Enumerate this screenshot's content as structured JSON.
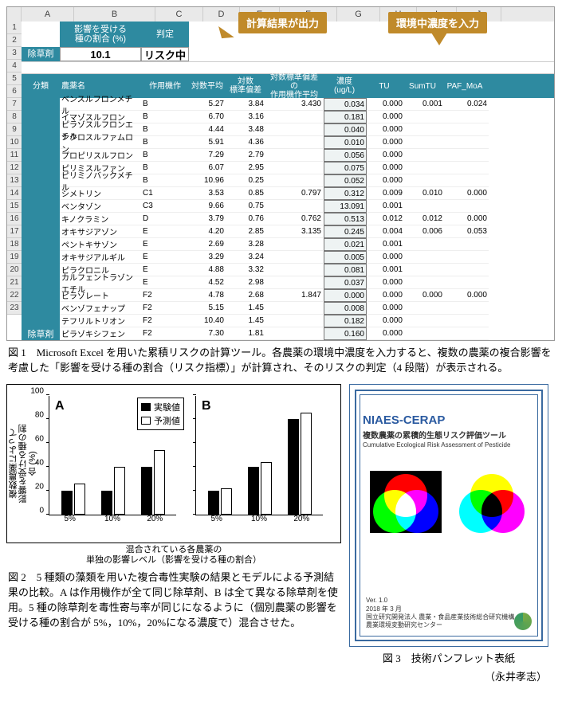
{
  "excel": {
    "col_letters": [
      "A",
      "B",
      "C",
      "D",
      "E",
      "F",
      "G",
      "H",
      "I",
      "J"
    ],
    "row_numbers": [
      "1",
      "2",
      "3",
      "4",
      "5",
      "6",
      "7",
      "8",
      "9",
      "10",
      "11",
      "12",
      "13",
      "14",
      "15",
      "16",
      "17",
      "18",
      "19",
      "20",
      "21",
      "22",
      "23"
    ],
    "top": {
      "ratio_header": "影響を受ける\n種の割合 (%)",
      "judgement_header": "判定",
      "category_label": "除草剤",
      "ratio_value": "10.1",
      "judgement_value": "リスク中"
    },
    "callouts": {
      "calc_out": "計算結果が出力",
      "conc_in": "環境中濃度を入力"
    },
    "headers": {
      "cat": "分類",
      "name": "農薬名",
      "moa": "作用機作",
      "logmean": "対数平均",
      "logsd": "対数\n標準偏差",
      "moasd": "対数標準偏差の\n作用機作平均",
      "conc": "濃度\n(ug/L)",
      "tu": "TU",
      "sumtu": "SumTU",
      "paf": "PAF_MoA"
    },
    "side_label": "除草剤",
    "rows": [
      {
        "name": "ベンスルフロンメチル",
        "moa": "B",
        "lm": "5.27",
        "lsd": "3.84",
        "msd": "3.430",
        "conc": "0.034",
        "tu": "0.000",
        "sumtu": "0.001",
        "paf": "0.024"
      },
      {
        "name": "イマゾスルフロン",
        "moa": "B",
        "lm": "6.70",
        "lsd": "3.16",
        "msd": "",
        "conc": "0.181",
        "tu": "0.000",
        "sumtu": "",
        "paf": ""
      },
      {
        "name": "ピラゾスルフロンエチル",
        "moa": "B",
        "lm": "4.44",
        "lsd": "3.48",
        "msd": "",
        "conc": "0.040",
        "tu": "0.000",
        "sumtu": "",
        "paf": ""
      },
      {
        "name": "シクロスルファムロン",
        "moa": "B",
        "lm": "5.91",
        "lsd": "4.36",
        "msd": "",
        "conc": "0.010",
        "tu": "0.000",
        "sumtu": "",
        "paf": ""
      },
      {
        "name": "プロピリスルフロン",
        "moa": "B",
        "lm": "7.29",
        "lsd": "2.79",
        "msd": "",
        "conc": "0.056",
        "tu": "0.000",
        "sumtu": "",
        "paf": ""
      },
      {
        "name": "ピリミスルファン",
        "moa": "B",
        "lm": "6.07",
        "lsd": "2.95",
        "msd": "",
        "conc": "0.075",
        "tu": "0.000",
        "sumtu": "",
        "paf": ""
      },
      {
        "name": "ピリミノバックメチル",
        "moa": "B",
        "lm": "10.96",
        "lsd": "0.25",
        "msd": "",
        "conc": "0.052",
        "tu": "0.000",
        "sumtu": "",
        "paf": ""
      },
      {
        "name": "シメトリン",
        "moa": "C1",
        "lm": "3.53",
        "lsd": "0.85",
        "msd": "0.797",
        "conc": "0.312",
        "tu": "0.009",
        "sumtu": "0.010",
        "paf": "0.000"
      },
      {
        "name": "ベンタゾン",
        "moa": "C3",
        "lm": "9.66",
        "lsd": "0.75",
        "msd": "",
        "conc": "13.091",
        "tu": "0.001",
        "sumtu": "",
        "paf": ""
      },
      {
        "name": "キノクラミン",
        "moa": "D",
        "lm": "3.79",
        "lsd": "0.76",
        "msd": "0.762",
        "conc": "0.513",
        "tu": "0.012",
        "sumtu": "0.012",
        "paf": "0.000"
      },
      {
        "name": "オキサジアゾン",
        "moa": "E",
        "lm": "4.20",
        "lsd": "2.85",
        "msd": "3.135",
        "conc": "0.245",
        "tu": "0.004",
        "sumtu": "0.006",
        "paf": "0.053"
      },
      {
        "name": "ペントキサゾン",
        "moa": "E",
        "lm": "2.69",
        "lsd": "3.28",
        "msd": "",
        "conc": "0.021",
        "tu": "0.001",
        "sumtu": "",
        "paf": ""
      },
      {
        "name": "オキサジアルギル",
        "moa": "E",
        "lm": "3.29",
        "lsd": "3.24",
        "msd": "",
        "conc": "0.005",
        "tu": "0.000",
        "sumtu": "",
        "paf": ""
      },
      {
        "name": "ピラクロニル",
        "moa": "E",
        "lm": "4.88",
        "lsd": "3.32",
        "msd": "",
        "conc": "0.081",
        "tu": "0.001",
        "sumtu": "",
        "paf": ""
      },
      {
        "name": "カルフェントラゾンエチル",
        "moa": "E",
        "lm": "4.52",
        "lsd": "2.98",
        "msd": "",
        "conc": "0.037",
        "tu": "0.000",
        "sumtu": "",
        "paf": ""
      },
      {
        "name": "ピラゾレート",
        "moa": "F2",
        "lm": "4.78",
        "lsd": "2.68",
        "msd": "1.847",
        "conc": "0.000",
        "tu": "0.000",
        "sumtu": "0.000",
        "paf": "0.000"
      },
      {
        "name": "ベンゾフェナップ",
        "moa": "F2",
        "lm": "5.15",
        "lsd": "1.45",
        "msd": "",
        "conc": "0.008",
        "tu": "0.000",
        "sumtu": "",
        "paf": ""
      },
      {
        "name": "テフリルトリオン",
        "moa": "F2",
        "lm": "10.40",
        "lsd": "1.45",
        "msd": "",
        "conc": "0.182",
        "tu": "0.000",
        "sumtu": "",
        "paf": ""
      },
      {
        "name": "ピラゾキシフェン",
        "moa": "F2",
        "lm": "7.30",
        "lsd": "1.81",
        "msd": "",
        "conc": "0.160",
        "tu": "0.000",
        "sumtu": "",
        "paf": ""
      }
    ]
  },
  "caption1": "図 1　Microsoft Excel を用いた累積リスクの計算ツール。各農薬の環境中濃度を入力すると、複数の農薬の複合影響を考慮した「影響を受ける種の割合（リスク指標）」が計算され、そのリスクの判定（4 段階）が表示される。",
  "chart_data": [
    {
      "type": "bar",
      "panel": "A",
      "categories": [
        "5%",
        "10%",
        "20%"
      ],
      "series": [
        {
          "name": "実験値",
          "values": [
            20,
            20,
            40
          ]
        },
        {
          "name": "予測値",
          "values": [
            26,
            40,
            54
          ]
        }
      ],
      "ylim": [
        0,
        100
      ],
      "ylabel": "複数農薬によって\n影響を受ける種の割合 (%)",
      "xlabel": "混合されている各農薬の\n単独の影響レベル（影響を受ける種の割合）"
    },
    {
      "type": "bar",
      "panel": "B",
      "categories": [
        "5%",
        "10%",
        "20%"
      ],
      "series": [
        {
          "name": "実験値",
          "values": [
            20,
            40,
            80
          ]
        },
        {
          "name": "予測値",
          "values": [
            22,
            44,
            85
          ]
        }
      ],
      "ylim": [
        0,
        100
      ]
    }
  ],
  "legend": {
    "exp": "実験値",
    "pred": "予測値"
  },
  "y_ticks": [
    "0",
    "20",
    "40",
    "60",
    "80",
    "100"
  ],
  "caption2": "図 2　5 種類の藻類を用いた複合毒性実験の結果とモデルによる予測結果の比較。A は作用機作が全て同じ除草剤、B は全て異なる除草剤を使用。5 種の除草剤を毒性寄与率が同じになるように（個別農薬の影響を受ける種の割合が 5%，10%，20%になる濃度で）混合させた。",
  "pamphlet": {
    "title": "NIAES-CERAP",
    "sub1": "複数農薬の累積的生態リスク評価ツール",
    "sub2": "Cumulative Ecological Risk Assessment of Pesticide",
    "ver": "Ver. 1.0",
    "date": "2018 年 3 月",
    "org1": "国立研究開発法人 農業・食品産業技術総合研究機構",
    "org2": "農業環境変動研究センター"
  },
  "caption3": "図 3　技術パンフレット表紙",
  "author": "（永井孝志）"
}
